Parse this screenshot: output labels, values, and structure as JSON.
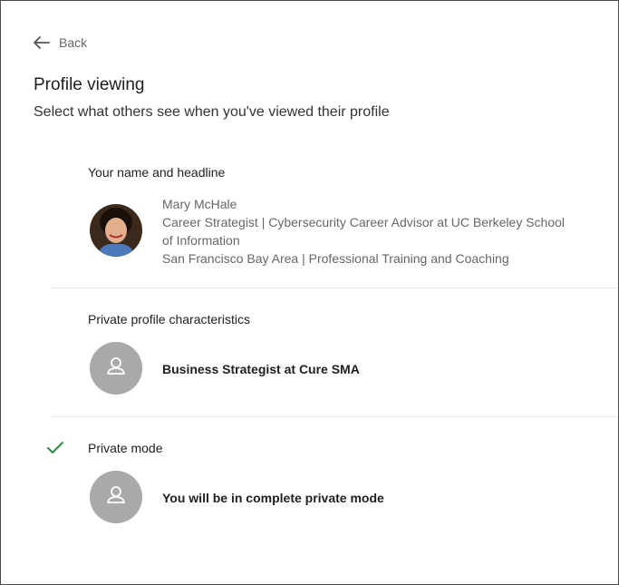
{
  "header": {
    "back_label": "Back",
    "title": "Profile viewing",
    "subtitle": "Select what others see when you've viewed their profile"
  },
  "options": [
    {
      "title": "Your name and headline",
      "name": "Mary McHale",
      "headline_line1": "Career Strategist | Cybersecurity Career Advisor at UC Berkeley School",
      "headline_line2": "of Information",
      "location": "San Francisco Bay Area | Professional Training and Coaching",
      "selected": false
    },
    {
      "title": "Private profile characteristics",
      "description": "Business Strategist at Cure SMA",
      "selected": false
    },
    {
      "title": "Private mode",
      "description": "You will be in complete private mode",
      "selected": true
    }
  ],
  "colors": {
    "check": "#2f8a4a",
    "avatar_placeholder": "#a7a9ab",
    "divider": "#e6e6e6"
  }
}
